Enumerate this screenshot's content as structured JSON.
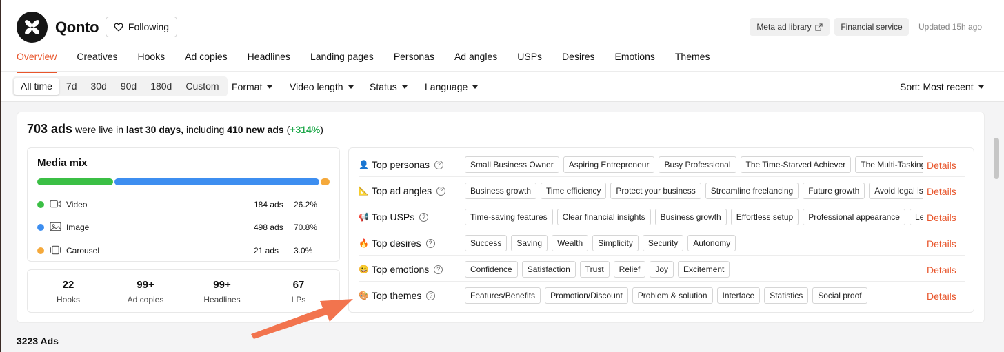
{
  "header": {
    "brand_name": "Qonto",
    "follow_label": "Following",
    "meta_ad_library_label": "Meta ad library",
    "category_label": "Financial service",
    "updated_label": "Updated 15h ago"
  },
  "tabs": [
    {
      "label": "Overview",
      "active": true
    },
    {
      "label": "Creatives"
    },
    {
      "label": "Hooks"
    },
    {
      "label": "Ad copies"
    },
    {
      "label": "Headlines"
    },
    {
      "label": "Landing pages"
    },
    {
      "label": "Personas"
    },
    {
      "label": "Ad angles"
    },
    {
      "label": "USPs"
    },
    {
      "label": "Desires"
    },
    {
      "label": "Emotions"
    },
    {
      "label": "Themes"
    }
  ],
  "filters": {
    "time_ranges": [
      "All time",
      "7d",
      "30d",
      "90d",
      "180d",
      "Custom"
    ],
    "selected_time_range": "All time",
    "format_label": "Format",
    "video_length_label": "Video length",
    "status_label": "Status",
    "language_label": "Language",
    "sort_label": "Sort: Most recent"
  },
  "summary": {
    "ads_live": "703 ads",
    "text_were_live": "were live in",
    "period": "last 30 days,",
    "text_including": "including",
    "new_ads": "410 new ads",
    "paren_open": "(",
    "growth": "+314%",
    "paren_close": ")"
  },
  "media_mix": {
    "title": "Media mix",
    "colors": {
      "video": "#3bbf45",
      "image": "#3d8ef0",
      "carousel": "#f5a93b"
    },
    "items": [
      {
        "label": "Video",
        "count": "184 ads",
        "percent": "26.2%",
        "share": 0.262
      },
      {
        "label": "Image",
        "count": "498 ads",
        "percent": "70.8%",
        "share": 0.708
      },
      {
        "label": "Carousel",
        "count": "21 ads",
        "percent": "3.0%",
        "share": 0.03
      }
    ]
  },
  "stats": [
    {
      "value": "22",
      "label": "Hooks"
    },
    {
      "value": "99+",
      "label": "Ad copies"
    },
    {
      "value": "99+",
      "label": "Headlines"
    },
    {
      "value": "67",
      "label": "LPs"
    }
  ],
  "tops": {
    "details_label": "Details",
    "rows": [
      {
        "label": "Top personas",
        "icon": "person-emoji",
        "glyph": "👤",
        "tags": [
          "Small Business Owner",
          "Aspiring Entrepreneur",
          "Busy Professional",
          "The Time-Starved Achiever",
          "The Multi-Tasking Pro"
        ]
      },
      {
        "label": "Top ad angles",
        "icon": "triangle-ruler-emoji",
        "glyph": "📐",
        "tags": [
          "Business growth",
          "Time efficiency",
          "Protect your business",
          "Streamline freelancing",
          "Future growth",
          "Avoid legal issues"
        ]
      },
      {
        "label": "Top USPs",
        "icon": "megaphone-emoji",
        "glyph": "📢",
        "tags": [
          "Time-saving features",
          "Clear financial insights",
          "Business growth",
          "Effortless setup",
          "Professional appearance",
          "Legal"
        ]
      },
      {
        "label": "Top desires",
        "icon": "fire-emoji",
        "glyph": "🔥",
        "tags": [
          "Success",
          "Saving",
          "Wealth",
          "Simplicity",
          "Security",
          "Autonomy"
        ]
      },
      {
        "label": "Top emotions",
        "icon": "smile-emoji",
        "glyph": "😀",
        "tags": [
          "Confidence",
          "Satisfaction",
          "Trust",
          "Relief",
          "Joy",
          "Excitement"
        ]
      },
      {
        "label": "Top themes",
        "icon": "palette-emoji",
        "glyph": "🎨",
        "tags": [
          "Features/Benefits",
          "Promotion/Discount",
          "Problem & solution",
          "Interface",
          "Statistics",
          "Social proof"
        ]
      }
    ]
  },
  "ads_count_label": "3223 Ads",
  "colors": {
    "accent": "#e8552b",
    "positive": "#1ea84a",
    "arrow": "#f2744e"
  }
}
